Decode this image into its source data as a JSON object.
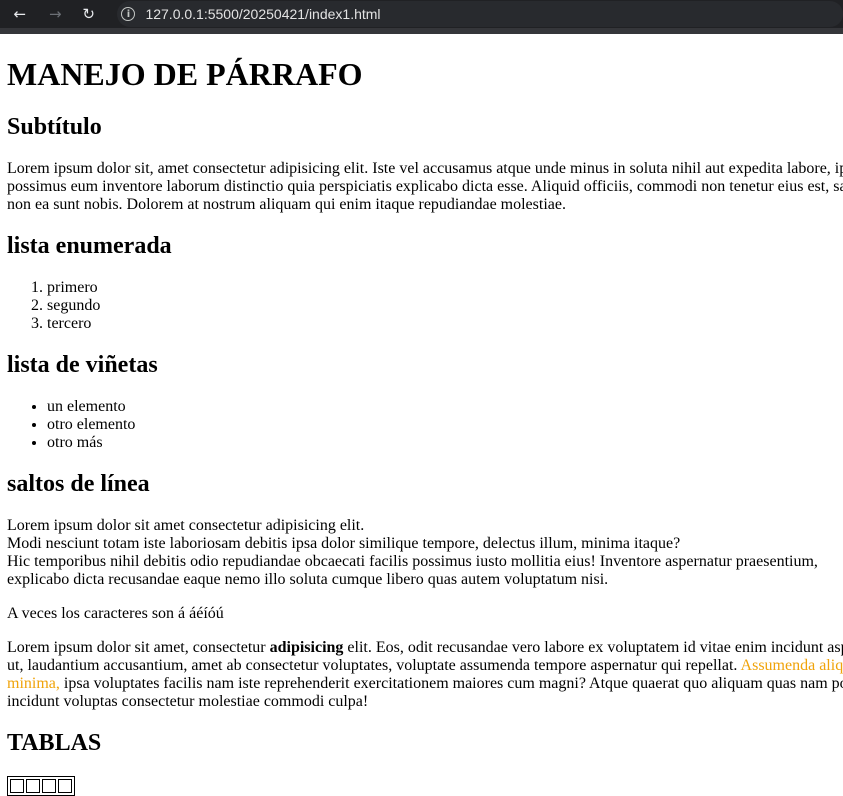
{
  "browser": {
    "back_icon": "←",
    "forward_icon": "→",
    "reload_icon": "↻",
    "url": "127.0.0.1:5500/20250421/index1.html"
  },
  "page": {
    "title": "MANEJO DE PÁRRAFO",
    "subtitle": "Subtítulo",
    "para1_lines": [
      "Lorem ipsum dolor sit, amet consectetur adipisicing elit. Iste vel accusamus atque unde minus in soluta nihil aut expedita labore, ip",
      "possimus eum inventore laborum distinctio quia perspiciatis explicabo dicta esse. Aliquid officiis, commodi non tenetur eius est, sa",
      "non ea sunt nobis. Dolorem at nostrum aliquam qui enim itaque repudiandae molestiae."
    ],
    "ordered_heading": "lista enumerada",
    "ordered_items": [
      "primero",
      "segundo",
      "tercero"
    ],
    "bullet_heading": "lista de viñetas",
    "bullet_items": [
      "un elemento",
      "otro elemento",
      "otro más"
    ],
    "breaks_heading": "saltos de línea",
    "breaks_lines": [
      "Lorem ipsum dolor sit amet consectetur adipisicing elit.",
      "Modi nesciunt totam iste laboriosam debitis ipsa dolor similique tempore, delectus illum, minima itaque?",
      "Hic temporibus nihil debitis odio repudiandae obcaecati facilis possimus iusto mollitia eius! Inventore aspernatur praesentium,",
      "explicabo dicta recusandae eaque nemo illo soluta cumque libero quas autem voluptatum nisi."
    ],
    "chars_text": "A veces los caracteres son á áéíóú",
    "para3": {
      "l1_a": "Lorem ipsum dolor sit amet, consectetur ",
      "l1_bold": "adipisicing",
      "l1_b": " elit. Eos, odit recusandae vero labore ex voluptatem id vitae enim incidunt asp",
      "l2_a": "ut, laudantium accusantium, amet ab consectetur voluptates, voluptate assumenda tempore aspernatur qui repellat. ",
      "l2_highlight": "Assumenda aliq",
      "l3_highlight": "minima,",
      "l3_b": " ipsa voluptates facilis nam iste reprehenderit exercitationem maiores cum magni? Atque quaerat quo aliquam quas nam po",
      "l4": "incidunt voluptas consectetur molestiae commodi culpa!"
    },
    "tables_heading": "TABLAS"
  },
  "colors": {
    "highlight": "#f0a30a",
    "toolbar": "#202124"
  }
}
